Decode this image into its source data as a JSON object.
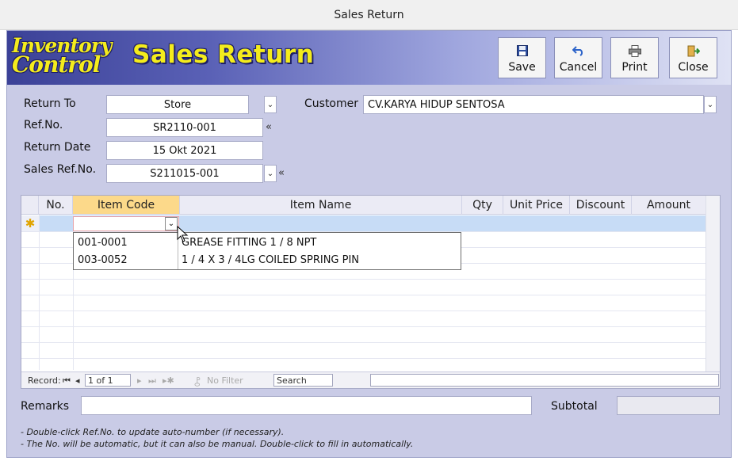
{
  "window_title": "Sales Return",
  "header": {
    "logo_line1": "Inventory",
    "logo_line2": "Control",
    "form_title": "Sales Return"
  },
  "toolbar": {
    "save": "Save",
    "cancel": "Cancel",
    "print": "Print",
    "close": "Close"
  },
  "form": {
    "return_to_label": "Return To",
    "return_to_value": "Store",
    "ref_no_label": "Ref.No.",
    "ref_no_value": "SR2110-001",
    "return_date_label": "Return Date",
    "return_date_value": "15 Okt 2021",
    "sales_ref_label": "Sales Ref.No.",
    "sales_ref_value": "S211015-001",
    "customer_label": "Customer",
    "customer_value": "CV.KARYA HIDUP SENTOSA",
    "raquo": "«"
  },
  "grid": {
    "columns": [
      "No.",
      "Item Code",
      "Item Name",
      "Qty",
      "Unit Price",
      "Discount",
      "Amount"
    ],
    "new_row_marker": "✱",
    "dropdown_items": [
      {
        "code": "001-0001",
        "name": "GREASE FITTING 1 / 8 NPT"
      },
      {
        "code": "003-0052",
        "name": "1 / 4 X 3 / 4LG COILED SPRING PIN"
      }
    ]
  },
  "record_nav": {
    "label": "Record:",
    "position": "1 of 1",
    "filter": "No Filter",
    "search": "Search"
  },
  "footer": {
    "remarks_label": "Remarks",
    "remarks_value": "",
    "subtotal_label": "Subtotal",
    "subtotal_value": ""
  },
  "notes": [
    "- Double-click Ref.No. to update auto-number (if necessary).",
    "- The No. will be automatic, but it can also be manual. Double-click to fill in automatically."
  ],
  "colors": {
    "header_start": "#3b4197",
    "title_yellow": "#f4ec1c",
    "form_bg": "#c9cbe6",
    "selected_header": "#fcd98a",
    "new_row": "#c7dcf6"
  }
}
